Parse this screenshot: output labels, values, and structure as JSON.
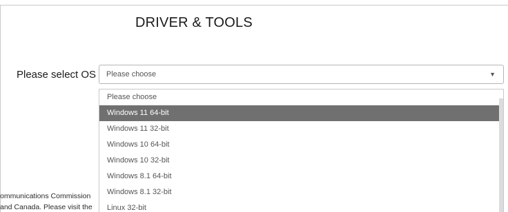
{
  "header": {
    "title": "DRIVER & TOOLS"
  },
  "os_select": {
    "label": "Please select OS",
    "value": "Please choose",
    "arrow": "▼",
    "options": [
      "Please choose",
      "Windows 11 64-bit",
      "Windows 11 32-bit",
      "Windows 10 64-bit",
      "Windows 10 32-bit",
      "Windows 8.1 64-bit",
      "Windows 8.1 32-bit",
      "Linux 32-bit"
    ],
    "highlighted_option": "Windows 11 64-bit"
  },
  "footer": {
    "line1": "ommunications Commission",
    "line2": "and Canada. Please visit the"
  },
  "colors": {
    "highlight": "#707070",
    "border": "#b5b5b5"
  }
}
